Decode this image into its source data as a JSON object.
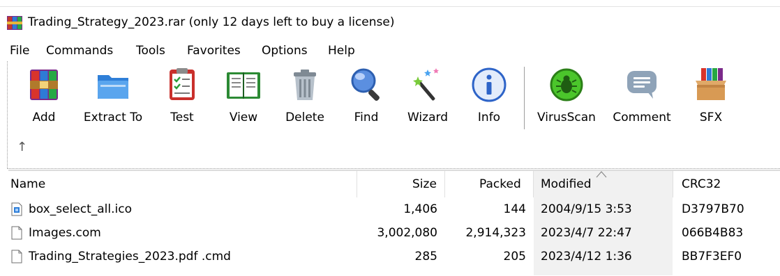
{
  "window": {
    "title": "Trading_Strategy_2023.rar (only 12 days left to buy a license)"
  },
  "menu": [
    "File",
    "Commands",
    "Tools",
    "Favorites",
    "Options",
    "Help"
  ],
  "toolbar": {
    "buttons": [
      {
        "label": "Add",
        "icon": "add-archive-icon"
      },
      {
        "label": "Extract To",
        "icon": "extract-folder-icon"
      },
      {
        "label": "Test",
        "icon": "test-checklist-icon"
      },
      {
        "label": "View",
        "icon": "view-book-icon"
      },
      {
        "label": "Delete",
        "icon": "trash-can-icon"
      },
      {
        "label": "Find",
        "icon": "magnifier-icon"
      },
      {
        "label": "Wizard",
        "icon": "magic-wand-icon"
      },
      {
        "label": "Info",
        "icon": "info-icon"
      },
      {
        "label": "VirusScan",
        "icon": "virus-scan-icon"
      },
      {
        "label": "Comment",
        "icon": "comment-bubble-icon"
      },
      {
        "label": "SFX",
        "icon": "sfx-box-icon"
      }
    ],
    "up_arrow": "↑"
  },
  "file_list": {
    "columns": {
      "name": "Name",
      "size": "Size",
      "packed": "Packed",
      "modified": "Modified",
      "crc": "CRC32"
    },
    "sorted_by": "Modified",
    "rows": [
      {
        "name": "box_select_all.ico",
        "size": "1,406",
        "packed": "144",
        "modified": "2004/9/15 3:53",
        "crc": "D3797B70",
        "icon": "image-file-icon"
      },
      {
        "name": "Images.com",
        "size": "3,002,080",
        "packed": "2,914,323",
        "modified": "2023/4/7 22:47",
        "crc": "066B4B83",
        "icon": "blank-file-icon"
      },
      {
        "name": "Trading_Strategies_2023.pdf .cmd",
        "size": "285",
        "packed": "205",
        "modified": "2023/4/12 1:36",
        "crc": "BB7F3EF0",
        "icon": "blank-file-icon"
      }
    ]
  },
  "colors": {
    "modified_column_bg": "#f1f1f1",
    "separator": "#9d9d9d"
  }
}
